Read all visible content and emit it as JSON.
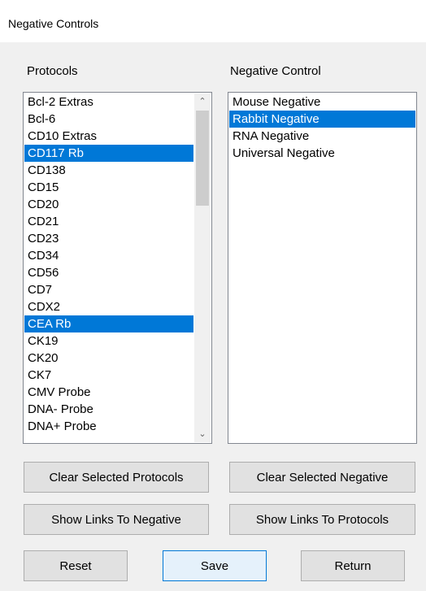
{
  "window": {
    "title": "Negative Controls"
  },
  "protocols": {
    "label": "Protocols",
    "items": [
      {
        "text": "Bcl-2 Extras",
        "selected": false
      },
      {
        "text": "Bcl-6",
        "selected": false
      },
      {
        "text": "CD10 Extras",
        "selected": false
      },
      {
        "text": "CD117 Rb",
        "selected": true
      },
      {
        "text": "CD138",
        "selected": false
      },
      {
        "text": "CD15",
        "selected": false
      },
      {
        "text": "CD20",
        "selected": false
      },
      {
        "text": "CD21",
        "selected": false
      },
      {
        "text": "CD23",
        "selected": false
      },
      {
        "text": "CD34",
        "selected": false
      },
      {
        "text": "CD56",
        "selected": false
      },
      {
        "text": "CD7",
        "selected": false
      },
      {
        "text": "CDX2",
        "selected": false
      },
      {
        "text": "CEA Rb",
        "selected": true
      },
      {
        "text": "CK19",
        "selected": false
      },
      {
        "text": "CK20",
        "selected": false
      },
      {
        "text": "CK7",
        "selected": false
      },
      {
        "text": "CMV Probe",
        "selected": false
      },
      {
        "text": "DNA- Probe",
        "selected": false
      },
      {
        "text": "DNA+ Probe",
        "selected": false
      }
    ]
  },
  "negatives": {
    "label": "Negative Control",
    "items": [
      {
        "text": "Mouse Negative",
        "selected": false
      },
      {
        "text": "Rabbit Negative",
        "selected": true
      },
      {
        "text": "RNA Negative",
        "selected": false
      },
      {
        "text": "Universal Negative",
        "selected": false
      }
    ]
  },
  "buttons": {
    "clear_protocols": "Clear Selected Protocols",
    "clear_negative": "Clear Selected Negative",
    "links_to_negative": "Show Links To Negative",
    "links_to_protocols": "Show Links To Protocols",
    "reset": "Reset",
    "save": "Save",
    "return": "Return"
  },
  "icons": {
    "scroll_up": "chevron-up-icon",
    "scroll_down": "chevron-down-icon"
  },
  "colors": {
    "selection": "#0078d7",
    "accent_button_border": "#0078d7"
  }
}
